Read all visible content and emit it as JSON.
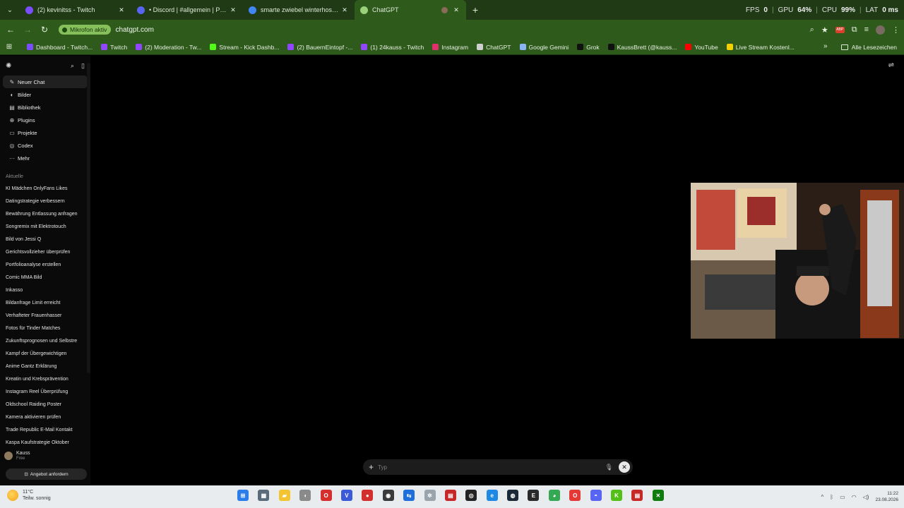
{
  "browser": {
    "tabs": [
      {
        "title": "(2) kevinitss - Twitch",
        "color": "#7c4dff",
        "active": false
      },
      {
        "title": "• Discord | #allgemein | Posching",
        "color": "#5865f2",
        "active": false
      },
      {
        "title": "smarte zwiebel winterhose - Go",
        "color": "#4285f4",
        "active": false
      },
      {
        "title": "ChatGPT",
        "color": "#9ad07a",
        "active": true
      }
    ],
    "new_tab": "+",
    "perf": {
      "fps_label": "FPS",
      "fps": "0",
      "gpu_label": "GPU",
      "gpu": "64%",
      "cpu_label": "CPU",
      "cpu": "99%",
      "lat_label": "LAT",
      "lat": "0 ms"
    },
    "address": {
      "mic_label": "Mikrofon aktiv",
      "url": "chatgpt.com"
    },
    "bookmarks": [
      {
        "label": "Dashboard - Twitch...",
        "color": "#7c4dff"
      },
      {
        "label": "Twitch",
        "color": "#9146ff"
      },
      {
        "label": "(2) Moderation - Tw...",
        "color": "#9146ff"
      },
      {
        "label": "Stream - Kick Dashb...",
        "color": "#53fc18"
      },
      {
        "label": "(2) BauernEintopf -...",
        "color": "#9146ff"
      },
      {
        "label": "(1) 24kauss - Twitch",
        "color": "#9146ff"
      },
      {
        "label": "Instagram",
        "color": "#e1306c"
      },
      {
        "label": "ChatGPT",
        "color": "#cfcfcf"
      },
      {
        "label": "Google Gemini",
        "color": "#8ab4f8"
      },
      {
        "label": "Grok",
        "color": "#111111"
      },
      {
        "label": "KaussBrett (@kauss...",
        "color": "#111111"
      },
      {
        "label": "YouTube",
        "color": "#ff0000"
      },
      {
        "label": "Live Stream Kostenl...",
        "color": "#f5d000"
      }
    ],
    "bookmarks_more": "»",
    "all_bookmarks": "Alle Lesezeichen"
  },
  "sidebar": {
    "nav": [
      {
        "label": "Neuer Chat",
        "icon": "edit-icon",
        "glyph": "✎",
        "active": true
      },
      {
        "label": "Bilder",
        "icon": "image-icon",
        "glyph": "◐",
        "active": false
      },
      {
        "label": "Bibliothek",
        "icon": "library-icon",
        "glyph": "▤",
        "active": false
      },
      {
        "label": "Plugins",
        "icon": "plugins-icon",
        "glyph": "⊕",
        "active": false
      },
      {
        "label": "Projekte",
        "icon": "folder-icon",
        "glyph": "▭",
        "active": false
      },
      {
        "label": "Codex",
        "icon": "codex-icon",
        "glyph": "◎",
        "active": false
      },
      {
        "label": "Mehr",
        "icon": "more-icon",
        "glyph": "···",
        "active": false
      }
    ],
    "section": "Aktuelle",
    "chats": [
      "KI Mädchen OnlyFans Likes",
      "Datingstrategie verbessern",
      "Bewährung Entlassung anfragen",
      "Songremix mit Elektrotouch",
      "Bild von Jessi Q",
      "Gerichtsvollzieher überprüfen",
      "Portfolioanalyse erstellen",
      "Comic MMA Bild",
      "Inkasso",
      "Bildanfrage Limit erreicht",
      "Verhafteter Frauenhasser",
      "Fotos für Tinder Matches",
      "Zukunftsprognosen und Selbstre",
      "Kampf der Übergewichtigen",
      "Anime Gantz Erklärung",
      "Kreatin und Krebsprävention",
      "Instagram Reel Überprüfung",
      "Oldschool Raiding Poster",
      "Kamera aktivieren prüfen",
      "Trade Republic E-Mail Kontakt",
      "Kaspa Kaufstrategie Oktober"
    ],
    "user": {
      "name": "Kauss",
      "plan": "Free"
    },
    "offer_button": "Angebot anfordern"
  },
  "composer": {
    "placeholder": "Typ"
  },
  "taskbar": {
    "weather": {
      "temp": "11°C",
      "desc": "Teilw. sonnig"
    },
    "apps": [
      {
        "name": "start-icon",
        "color": "#2b7de9",
        "glyph": "⊞"
      },
      {
        "name": "calculator-icon",
        "color": "#5a6b7c",
        "glyph": "▦"
      },
      {
        "name": "file-explorer-icon",
        "color": "#f4c430",
        "glyph": "▰"
      },
      {
        "name": "mouse-icon",
        "color": "#8a8a8a",
        "glyph": "◖"
      },
      {
        "name": "opera-gx-icon",
        "color": "#d62d2d",
        "glyph": "O"
      },
      {
        "name": "v-app-icon",
        "color": "#3a5ad8",
        "glyph": "V"
      },
      {
        "name": "record-icon",
        "color": "#d32f2f",
        "glyph": "●"
      },
      {
        "name": "obs-icon",
        "color": "#3a3a3a",
        "glyph": "◉"
      },
      {
        "name": "teamviewer-icon",
        "color": "#1e6fd9",
        "glyph": "⇆"
      },
      {
        "name": "settings-app-icon",
        "color": "#9aa4ad",
        "glyph": "✲"
      },
      {
        "name": "streamlabs-icon",
        "color": "#c62828",
        "glyph": "▤"
      },
      {
        "name": "chatgpt-app-icon",
        "color": "#222222",
        "glyph": "◎"
      },
      {
        "name": "edge-icon",
        "color": "#1e88e5",
        "glyph": "e"
      },
      {
        "name": "steam-icon",
        "color": "#1b2838",
        "glyph": "◍"
      },
      {
        "name": "epic-games-icon",
        "color": "#2a2a2a",
        "glyph": "E"
      },
      {
        "name": "chrome-icon",
        "color": "#34a853",
        "glyph": "◕"
      },
      {
        "name": "opera-icon",
        "color": "#e53935",
        "glyph": "O"
      },
      {
        "name": "discord-icon",
        "color": "#5865f2",
        "glyph": "◓"
      },
      {
        "name": "kick-app-icon",
        "color": "#53c018",
        "glyph": "K"
      },
      {
        "name": "stream-app-icon",
        "color": "#c62828",
        "glyph": "▤"
      },
      {
        "name": "xbox-icon",
        "color": "#107c10",
        "glyph": "✕"
      }
    ],
    "tray_caret": "^",
    "time": "11:22",
    "date": "23.08.2026"
  }
}
